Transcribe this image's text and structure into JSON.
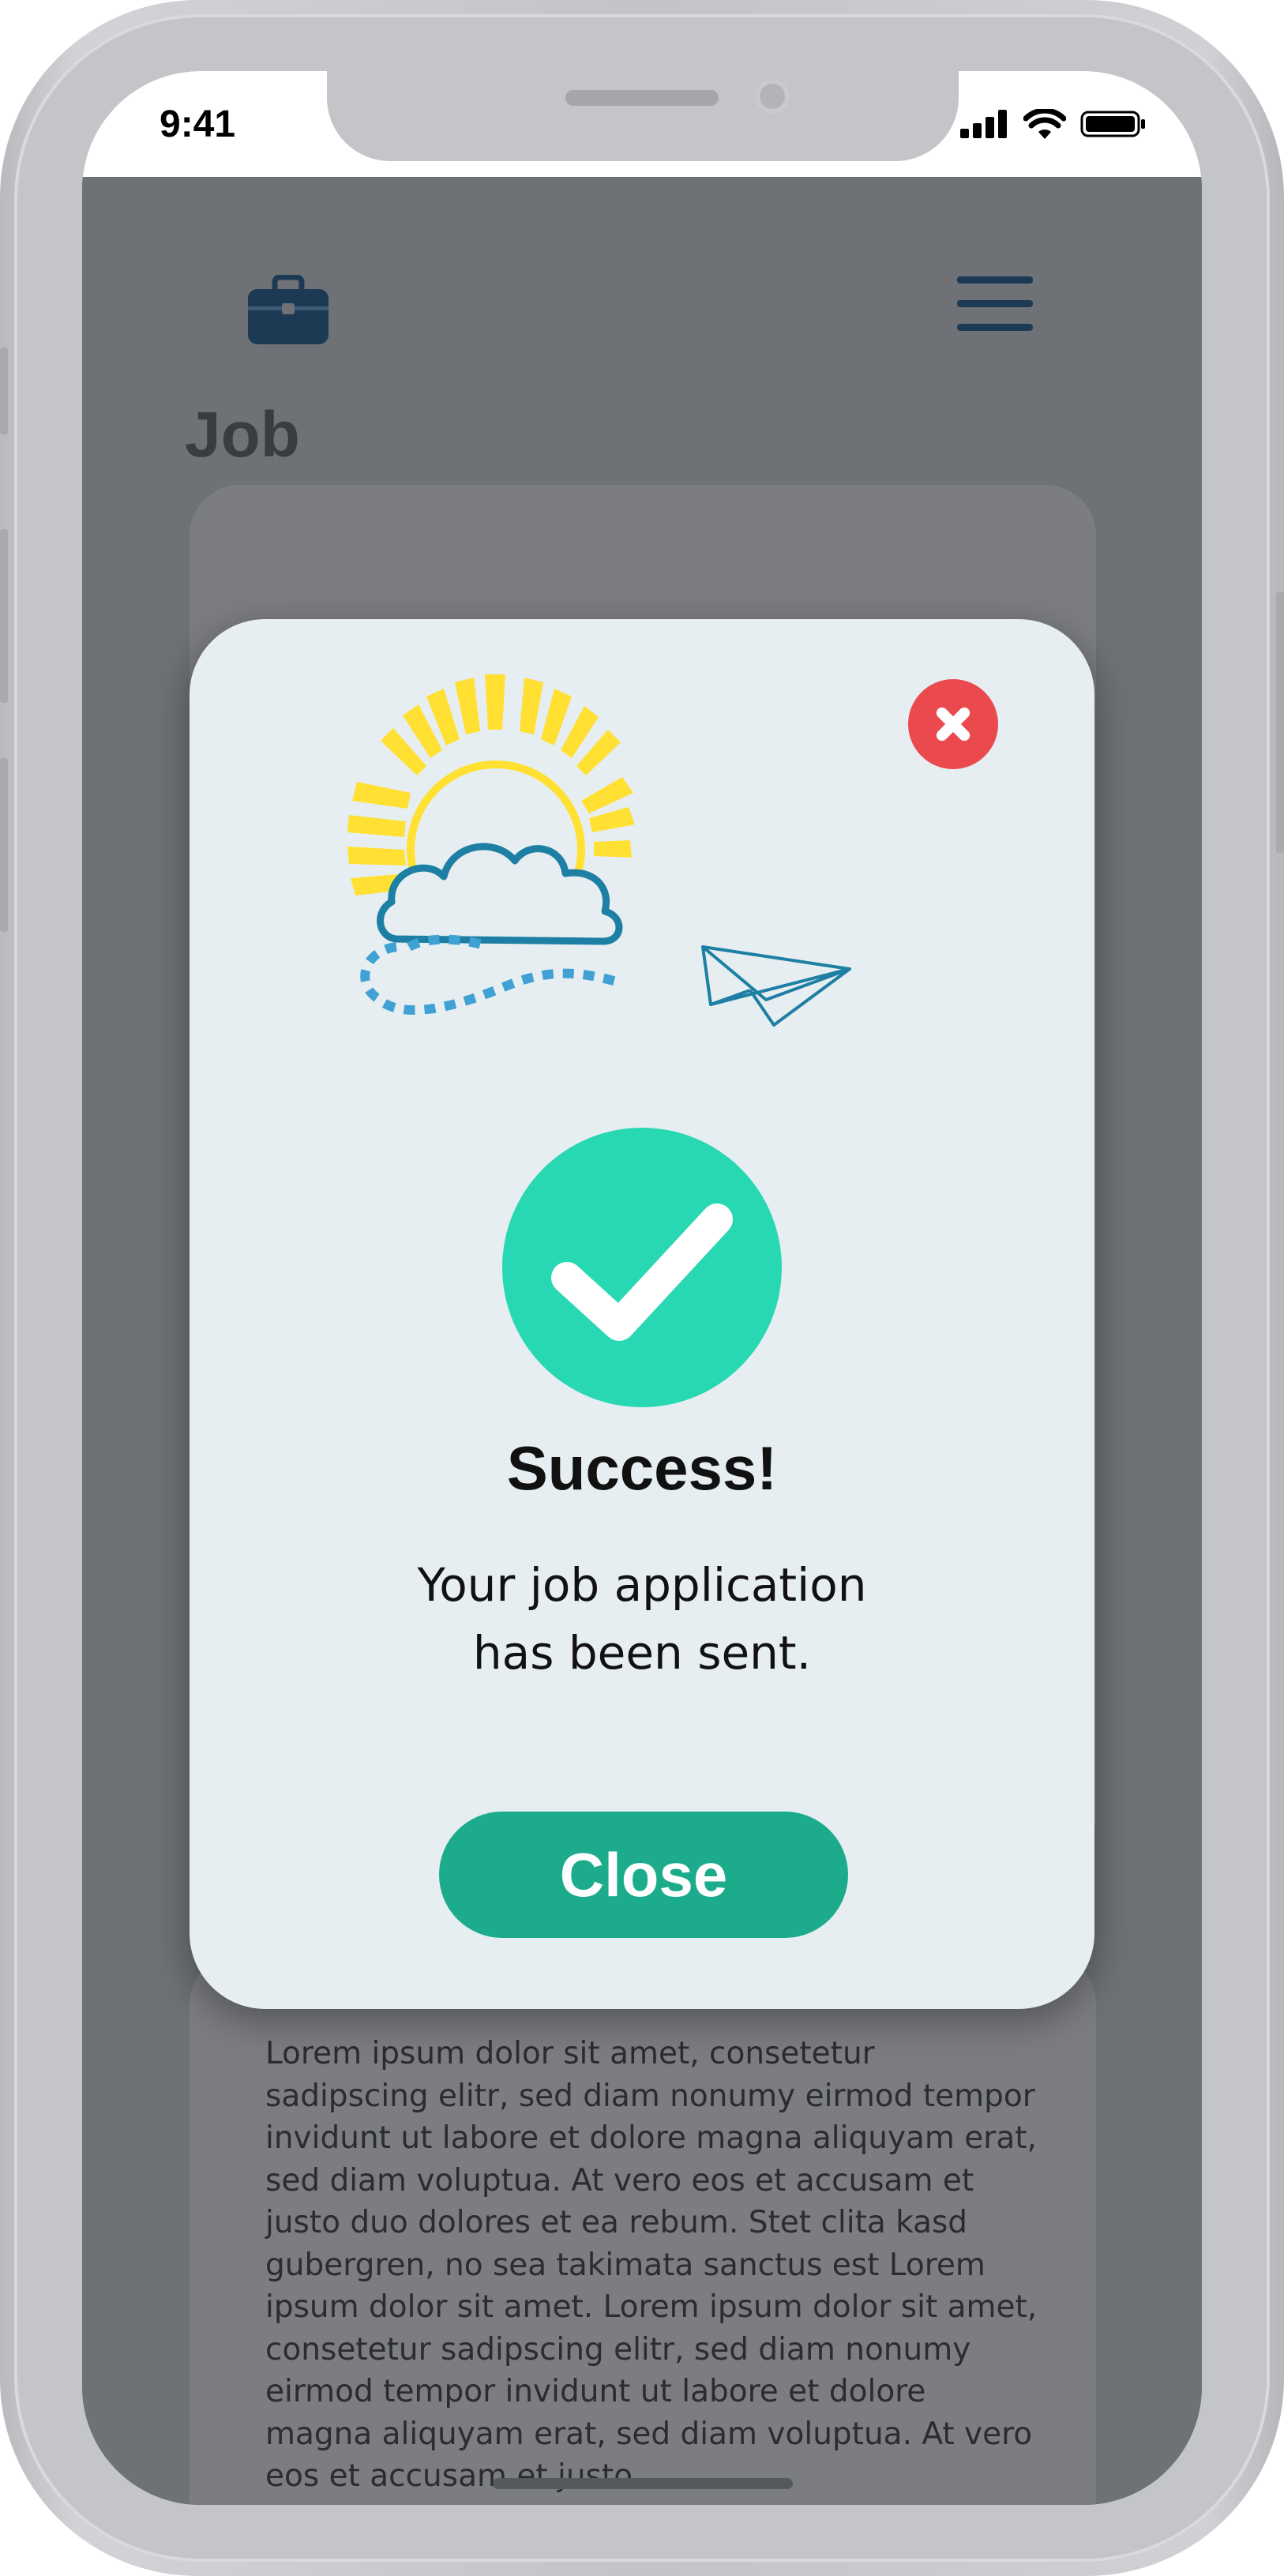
{
  "status_bar": {
    "time": "9:41"
  },
  "header": {
    "logo_icon": "briefcase-icon",
    "menu_icon": "hamburger-menu-icon"
  },
  "page": {
    "title": "Job"
  },
  "description": {
    "text": "Lorem ipsum dolor sit amet, consetetur sadipscing elitr, sed diam nonumy eirmod tempor invidunt ut labore et dolore magna aliquyam erat, sed diam voluptua. At vero eos et accusam et justo duo dolores et ea rebum. Stet clita kasd gubergren, no sea takimata sanctus est Lorem ipsum dolor sit amet. Lorem ipsum dolor sit amet, consetetur sadipscing elitr, sed diam nonumy eirmod tempor invidunt ut labore et dolore magna aliquyam erat, sed diam voluptua. At vero eos et accusam et justo"
  },
  "modal": {
    "title": "Success!",
    "message_line1": "Your job application",
    "message_line2": "has been sent.",
    "close_label": "Close",
    "dismiss_icon": "close-circle-icon",
    "status_icon": "checkmark-icon"
  },
  "colors": {
    "success_green": "#28d8b2",
    "button_green": "#1cac8c",
    "dismiss_red": "#ea4a4d",
    "navy": "#1d3a55",
    "sun_yellow": "#ffe033",
    "cloud_blue": "#1d7fa3"
  }
}
